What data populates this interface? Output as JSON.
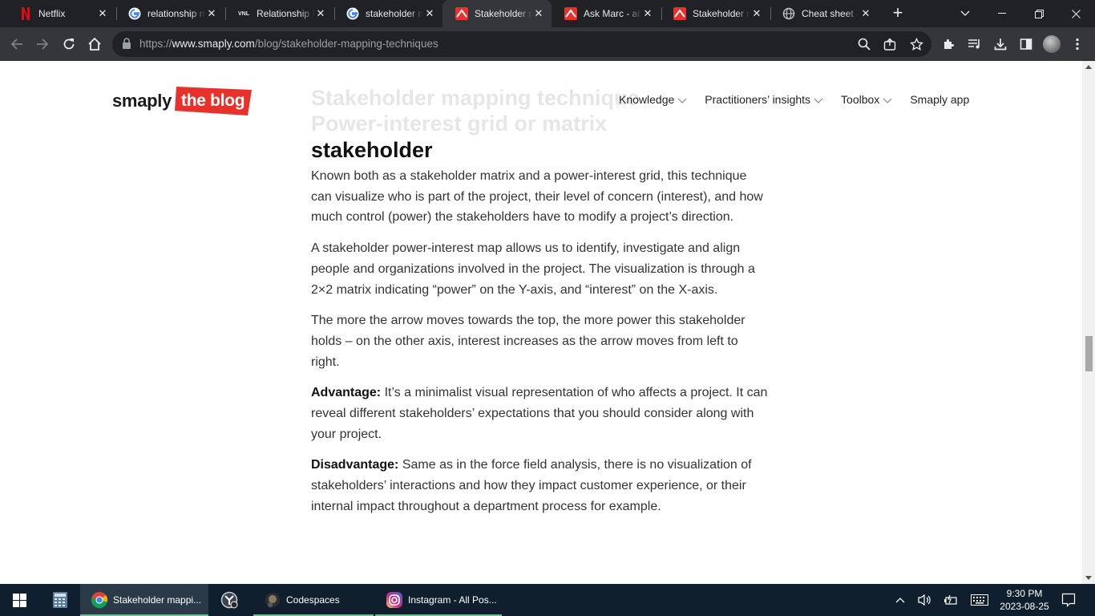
{
  "browser": {
    "tabs": [
      {
        "title": "Netflix",
        "icon": "netflix-icon"
      },
      {
        "title": "relationship map",
        "icon": "google-icon"
      },
      {
        "title": "Relationship Map",
        "icon": "vnl-icon"
      },
      {
        "title": "stakeholder map",
        "icon": "google-icon"
      },
      {
        "title": "Stakeholder map",
        "icon": "smaply-icon",
        "active": true
      },
      {
        "title": "Ask Marc - about",
        "icon": "smaply-icon"
      },
      {
        "title": "Stakeholder map",
        "icon": "smaply-icon"
      },
      {
        "title": "Cheat sheet -",
        "icon": "globe-icon"
      }
    ],
    "url_prefix": "https://",
    "url_domain": "www.smaply.com",
    "url_path": "/blog/stakeholder-mapping-techniques"
  },
  "site": {
    "logo_text": "smaply",
    "logo_badge": "the blog",
    "brand_color": "#e8312b",
    "nav": [
      {
        "label": "Knowledge",
        "dropdown": true
      },
      {
        "label": "Practitioners’ insights",
        "dropdown": true
      },
      {
        "label": "Toolbox",
        "dropdown": true
      },
      {
        "label": "Smaply app",
        "dropdown": false
      }
    ]
  },
  "article": {
    "faded_heading_1": "Stakeholder mapping technique",
    "faded_heading_2": "Power-interest grid or matrix",
    "heading": "stakeholder",
    "p1": "Known both as a stakeholder matrix and a power-interest grid, this technique can visualize who is part of the project, their level of concern (interest), and how much control (power) the stakeholders have to modify a project’s direction.",
    "p2": "A stakeholder power-interest map allows us to identify, investigate and align people and organizations involved in the project. The visualization is through a 2×2 matrix indicating “power” on the Y-axis, and “interest” on the X-axis.",
    "p3": "The more the arrow moves towards the top, the more power this stakeholder holds – on the other axis, interest increases as the arrow moves from left to right.",
    "adv_label": "Advantage:",
    "adv_text": " It’s a minimalist visual representation of who affects a project. It can reveal different stakeholders’ expectations that you should consider along with your project.",
    "dis_label": "Disadvantage:",
    "dis_text": " Same as in the force field analysis, there is no visualization of stakeholders’ interactions and how they impact customer experience, or their internal impact throughout a department process for example."
  },
  "taskbar": {
    "apps": [
      {
        "label": "",
        "icon": "calculator-icon"
      },
      {
        "label": "Stakeholder mappi...",
        "icon": "chrome-icon",
        "active": true
      },
      {
        "label": "",
        "icon": "app-icon"
      },
      {
        "label": "Codespaces",
        "icon": "codespaces-icon"
      },
      {
        "label": "Instagram - All Pos...",
        "icon": "instagram-icon"
      }
    ],
    "time": "9:30 PM",
    "date": "2023-08-25"
  }
}
